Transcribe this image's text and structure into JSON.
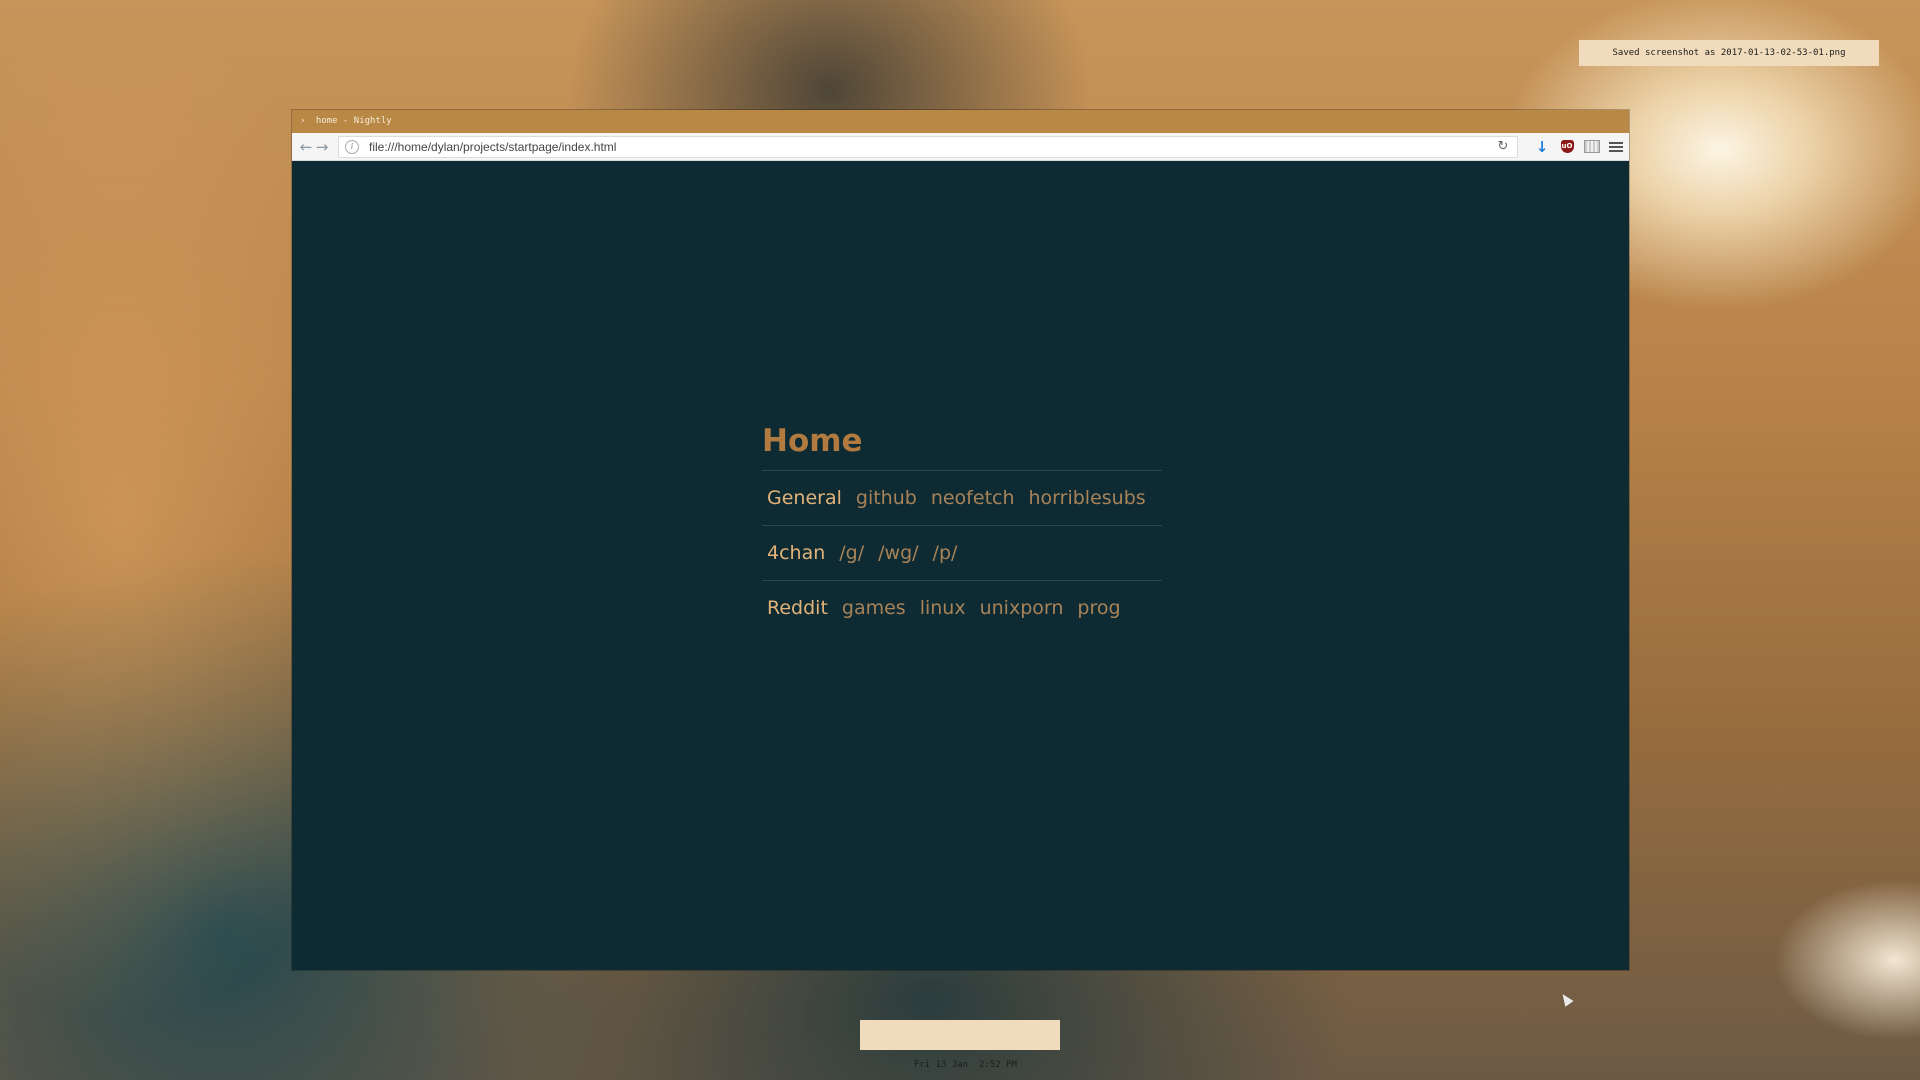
{
  "notification": {
    "text": "Saved screenshot as 2017-01-13-02-53-01.png"
  },
  "browser": {
    "window_title": "home - Nightly",
    "url": "file:///home/dylan/projects/startpage/index.html",
    "icons": {
      "back": "back-arrow-icon",
      "forward": "forward-arrow-icon",
      "info": "info-icon",
      "reload": "reload-icon",
      "download": "download-icon",
      "ublock": "ublock-origin-icon",
      "screenshot": "screenshot-icon",
      "menu": "hamburger-menu-icon"
    },
    "ublock_label": "uO"
  },
  "startpage": {
    "title": "Home",
    "rows": [
      {
        "heading": "General",
        "links": [
          "github",
          "neofetch",
          "horriblesubs"
        ]
      },
      {
        "heading": "4chan",
        "links": [
          "/g/",
          "/wg/",
          "/p/"
        ]
      },
      {
        "heading": "Reddit",
        "links": [
          "games",
          "linux",
          "unixporn",
          "prog"
        ]
      }
    ],
    "colors": {
      "background": "#0e2a33",
      "title": "#b07a40",
      "heading": "#e2b479",
      "link": "#a88358",
      "divider": "#2c4750"
    }
  },
  "clock": {
    "text": "Fri 13 Jan  2:52 PM"
  }
}
